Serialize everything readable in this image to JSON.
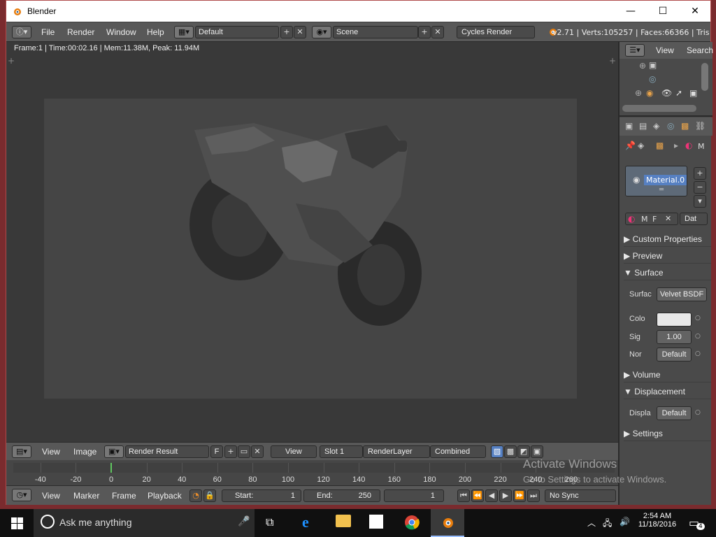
{
  "window": {
    "title": "Blender",
    "min": "—",
    "max": "☐",
    "close": "✕"
  },
  "menu": {
    "items": [
      "File",
      "Render",
      "Window",
      "Help"
    ],
    "layout": "Default",
    "scene": "Scene",
    "engine": "Cycles Render",
    "stats": "v2.71 | Verts:105257 | Faces:66366 | Tris"
  },
  "viewport": {
    "info": "Frame:1 | Time:00:02.16 | Mem:11.38M, Peak: 11.94M"
  },
  "image_header": {
    "view": "View",
    "image": "Image",
    "image_name": "Render Result",
    "fake_user": "F",
    "view_dd": "View",
    "slot": "Slot 1",
    "layer": "RenderLayer",
    "pass": "Combined"
  },
  "timeline": {
    "labels": [
      "-40",
      "-20",
      "0",
      "20",
      "40",
      "60",
      "80",
      "100",
      "120",
      "140",
      "160",
      "180",
      "200",
      "220",
      "240",
      "260"
    ],
    "current_frame": 0
  },
  "timeline_header": {
    "view": "View",
    "marker": "Marker",
    "frame": "Frame",
    "playback": "Playback",
    "start_label": "Start:",
    "start": "1",
    "end_label": "End:",
    "end": "250",
    "current": "1",
    "sync": "No Sync"
  },
  "outliner": {
    "view": "View",
    "search": "Search"
  },
  "properties": {
    "material_slot": "Material.0",
    "m_label": "M",
    "data_dd": "Dat",
    "f_btn": "F",
    "sections": {
      "custom": "Custom Properties",
      "preview": "Preview",
      "surface": "Surface",
      "volume": "Volume",
      "displacement": "Displacement",
      "settings": "Settings"
    },
    "surface_label": "Surfac",
    "surface_value": "Velvet BSDF",
    "color_label": "Colo",
    "sigma_label": "Sig",
    "sigma_value": "1.00",
    "normal_label": "Nor",
    "normal_value": "Default",
    "displa_label": "Displa",
    "displa_value": "Default"
  },
  "watermark": {
    "title": "Activate Windows",
    "sub": "Go to Settings to activate Windows."
  },
  "taskbar": {
    "search": "Ask me anything",
    "time": "2:54 AM",
    "date": "11/18/2016",
    "notif": "4"
  }
}
